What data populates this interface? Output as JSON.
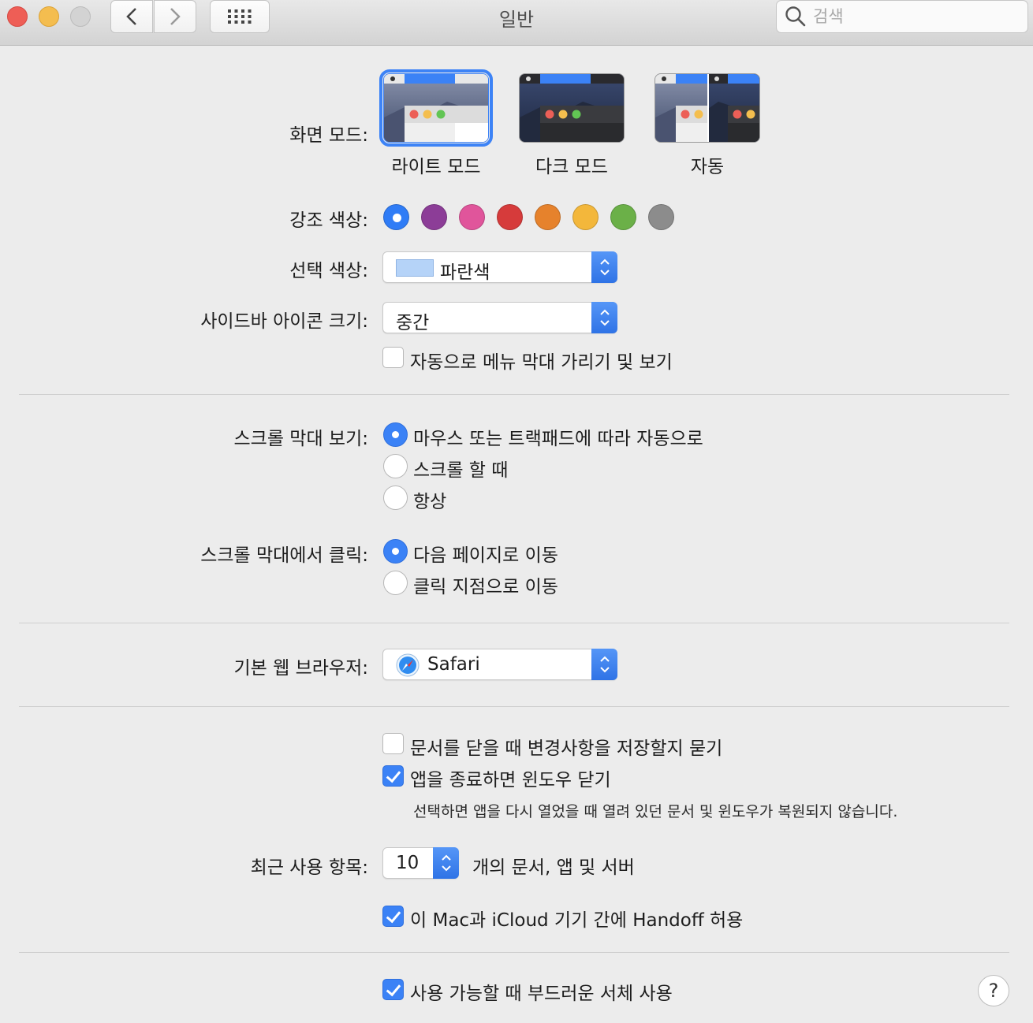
{
  "window": {
    "title": "일반",
    "search_placeholder": "검색"
  },
  "appearance": {
    "label": "화면 모드:",
    "options": [
      {
        "label": "라이트 모드",
        "selected": true
      },
      {
        "label": "다크 모드",
        "selected": false
      },
      {
        "label": "자동",
        "selected": false
      }
    ]
  },
  "accent_color": {
    "label": "강조 색상:",
    "colors": [
      "#2f7cf6",
      "#8c3d97",
      "#e0559b",
      "#d63b3b",
      "#e6822c",
      "#f3b73b",
      "#6bb048",
      "#8c8c8c"
    ],
    "selected_index": 0
  },
  "highlight_color": {
    "label": "선택 색상:",
    "value": "파란색",
    "swatch": "#b5d3f8"
  },
  "sidebar_icon_size": {
    "label": "사이드바 아이콘 크기:",
    "value": "중간"
  },
  "menubar_autohide": {
    "label": "자동으로 메뉴 막대 가리기 및 보기",
    "checked": false
  },
  "scrollbars": {
    "label": "스크롤 막대 보기:",
    "options": [
      {
        "label": "마우스 또는 트랙패드에 따라 자동으로",
        "selected": true
      },
      {
        "label": "스크롤 할 때",
        "selected": false
      },
      {
        "label": "항상",
        "selected": false
      }
    ]
  },
  "scroll_click": {
    "label": "스크롤 막대에서 클릭:",
    "options": [
      {
        "label": "다음 페이지로 이동",
        "selected": true
      },
      {
        "label": "클릭 지점으로 이동",
        "selected": false
      }
    ]
  },
  "default_browser": {
    "label": "기본 웹 브라우저:",
    "value": "Safari"
  },
  "ask_keep_changes": {
    "label": "문서를 닫을 때 변경사항을 저장할지 묻기",
    "checked": false
  },
  "close_windows": {
    "label": "앱을 종료하면 윈도우 닫기",
    "checked": true,
    "note": "선택하면 앱을 다시 열었을 때 열려 있던 문서 및 윈도우가 복원되지 않습니다."
  },
  "recent_items": {
    "label": "최근 사용 항목:",
    "value": "10",
    "suffix": "개의 문서, 앱 및 서버"
  },
  "handoff": {
    "label": "이 Mac과 iCloud 기기 간에 Handoff 허용",
    "checked": true
  },
  "font_smoothing": {
    "label": "사용 가능할 때 부드러운 서체 사용",
    "checked": true
  },
  "help": {
    "symbol": "?"
  }
}
